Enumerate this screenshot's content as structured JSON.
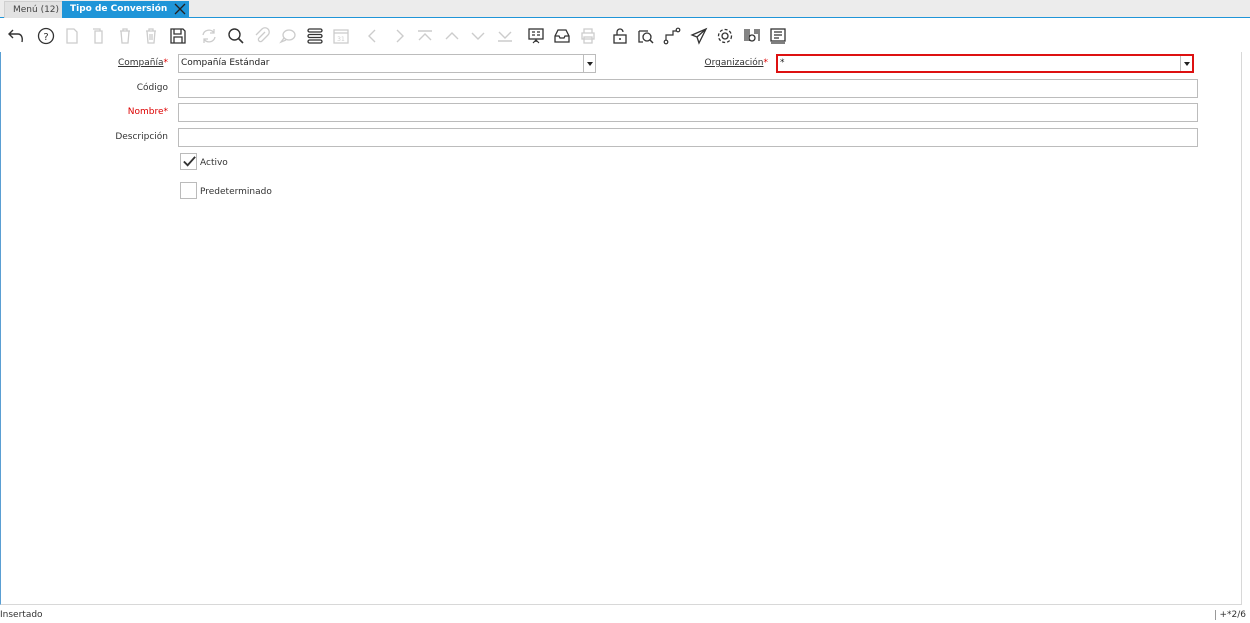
{
  "tabs": {
    "menu_label": "Menú (12)",
    "active_label": "Tipo de Conversión"
  },
  "toolbar": {
    "icons": [
      "undo-icon",
      "help-icon",
      "new-record-icon",
      "copy-record-icon",
      "delete-icon",
      "delete-selection-icon",
      "save-icon",
      "refresh-icon",
      "find-icon",
      "attachment-icon",
      "chat-icon",
      "grid-toggle-icon",
      "calendar-icon",
      "previous-record-icon",
      "next-record-icon",
      "first-record-icon",
      "parent-record-icon",
      "detail-record-icon",
      "last-record-icon",
      "report-icon",
      "archive-icon",
      "print-icon",
      "lock-icon",
      "zoom-across-icon",
      "workflow-icon",
      "request-icon",
      "process-icon",
      "product-info-icon",
      "export-icon"
    ]
  },
  "form": {
    "company_label": "Compañía",
    "company_value": "Compañía Estándar",
    "organization_label": "Organización",
    "organization_value": "*",
    "code_label": "Código",
    "code_value": "",
    "name_label": "Nombre",
    "name_value": "",
    "description_label": "Descripción",
    "description_value": "",
    "active_label": "Activo",
    "active_checked": true,
    "default_label": "Predeterminado",
    "default_checked": false,
    "required_mark": "*"
  },
  "status": {
    "message": "Insertado",
    "record_info": "+*2/6"
  },
  "colors": {
    "accent": "#1f95d8",
    "required": "#dd0000",
    "error_border": "#dd1111"
  }
}
